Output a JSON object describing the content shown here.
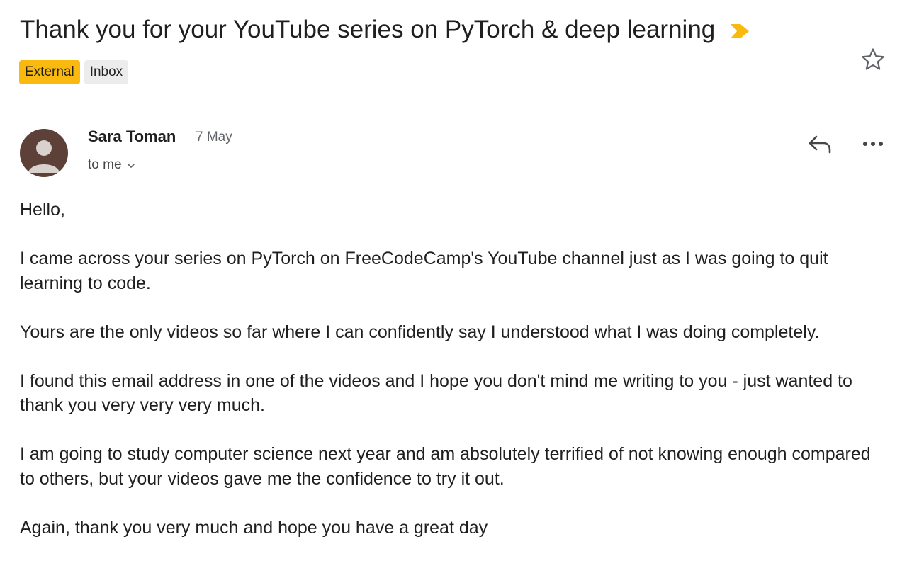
{
  "email": {
    "subject": "Thank you for your YouTube series on PyTorch & deep learning",
    "labels": [
      "External",
      "Inbox"
    ],
    "sender": {
      "name": "Sara Toman",
      "date": "7 May",
      "recipient": "to me"
    },
    "body": [
      "Hello,",
      "I came across your series on PyTorch on FreeCodeCamp's YouTube channel just as I was going to quit learning to code.",
      "Yours are the only videos so far where I can confidently say I understood what I was doing completely.",
      "I found this email address in one of the videos and I hope you don't mind me writing to you - just wanted to thank you very very very much.",
      "I am going to study computer science next year and am absolutely terrified of not knowing enough compared to others, but your videos gave me the confidence to try it out.",
      "Again, thank you very much and hope you have a great day"
    ]
  },
  "icons": {
    "importance": "importance-marker-icon",
    "star": "star-icon",
    "reply": "reply-arrow-icon",
    "more": "more-horizontal-icon",
    "chevron": "chevron-down-icon",
    "avatar": "default-avatar-icon"
  },
  "colors": {
    "external_label": "#f9b90f",
    "inbox_label": "#ececec",
    "importance_marker": "#f9b90f",
    "avatar_bg": "#5d4037"
  }
}
